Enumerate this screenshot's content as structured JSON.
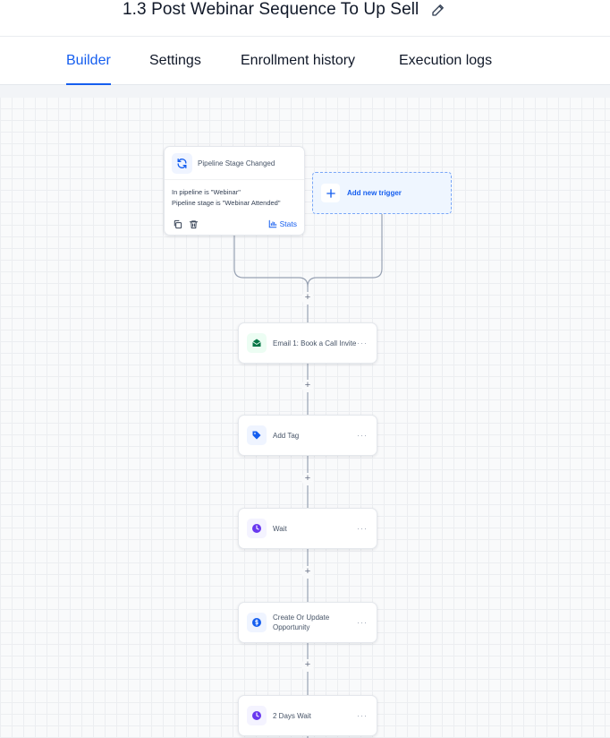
{
  "header": {
    "title": "1.3 Post Webinar Sequence To Up Sell"
  },
  "tabs": [
    {
      "label": "Builder",
      "active": true
    },
    {
      "label": "Settings",
      "active": false
    },
    {
      "label": "Enrollment history",
      "active": false
    },
    {
      "label": "Execution logs",
      "active": false
    }
  ],
  "trigger": {
    "title": "Pipeline Stage Changed",
    "conditions": [
      "In pipeline is \"Webinar\"",
      "Pipeline stage is \"Webinar Attended\""
    ],
    "stats_label": "Stats"
  },
  "add_trigger": {
    "label": "Add new trigger"
  },
  "add_step_symbol": "+",
  "more_symbol": "···",
  "actions": [
    {
      "label": "Email 1: Book a Call Invite",
      "icon": "envelope-icon",
      "icon_color": "#067647",
      "icon_bg": "#ecfdf3"
    },
    {
      "label": "Add Tag",
      "icon": "tag-icon",
      "icon_color": "#155eef",
      "icon_bg": "#eff4ff"
    },
    {
      "label": "Wait",
      "icon": "clock-icon",
      "icon_color": "#6938ef",
      "icon_bg": "#f4f3ff"
    },
    {
      "label": "Create Or Update Opportunity",
      "icon": "dollar-icon",
      "icon_color": "#155eef",
      "icon_bg": "#eff4ff"
    },
    {
      "label": "2 Days Wait",
      "icon": "clock-icon",
      "icon_color": "#6938ef",
      "icon_bg": "#f4f3ff"
    }
  ],
  "colors": {
    "accent": "#155eef",
    "canvas_bg": "#f9fafb",
    "connector": "#98a2b3"
  }
}
